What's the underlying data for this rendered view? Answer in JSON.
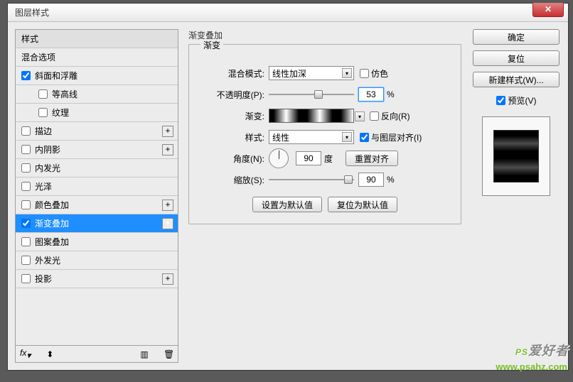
{
  "window": {
    "title": "图层样式"
  },
  "sidebar": {
    "header": "样式",
    "blendOptions": "混合选项",
    "items": [
      {
        "label": "斜面和浮雕",
        "checked": true,
        "plus": false,
        "indent": 1
      },
      {
        "label": "等高线",
        "checked": false,
        "plus": false,
        "indent": 2
      },
      {
        "label": "纹理",
        "checked": false,
        "plus": false,
        "indent": 2
      },
      {
        "label": "描边",
        "checked": false,
        "plus": true,
        "indent": 1
      },
      {
        "label": "内阴影",
        "checked": false,
        "plus": true,
        "indent": 1
      },
      {
        "label": "内发光",
        "checked": false,
        "plus": false,
        "indent": 1
      },
      {
        "label": "光泽",
        "checked": false,
        "plus": false,
        "indent": 1
      },
      {
        "label": "颜色叠加",
        "checked": false,
        "plus": true,
        "indent": 1
      },
      {
        "label": "渐变叠加",
        "checked": true,
        "plus": true,
        "indent": 1,
        "selected": true
      },
      {
        "label": "图案叠加",
        "checked": false,
        "plus": false,
        "indent": 1
      },
      {
        "label": "外发光",
        "checked": false,
        "plus": false,
        "indent": 1
      },
      {
        "label": "投影",
        "checked": false,
        "plus": true,
        "indent": 1
      }
    ],
    "footer": {
      "fx": "fx"
    }
  },
  "main": {
    "sectionTitle": "渐变叠加",
    "fieldsetTitle": "渐变",
    "blendMode": {
      "label": "混合模式:",
      "value": "线性加深"
    },
    "dither": "仿色",
    "opacity": {
      "label": "不透明度(P):",
      "value": "53",
      "percent": 53,
      "unit": "%"
    },
    "gradient": {
      "label": "渐变:"
    },
    "reverse": "反向(R)",
    "style": {
      "label": "样式:",
      "value": "线性"
    },
    "alignWithLayer": "与图层对齐(I)",
    "angle": {
      "label": "角度(N):",
      "value": "90",
      "unit": "度"
    },
    "resetAlign": "重置对齐",
    "scale": {
      "label": "缩放(S):",
      "value": "90",
      "percent": 90,
      "unit": "%"
    },
    "setDefault": "设置为默认值",
    "resetDefault": "复位为默认值"
  },
  "right": {
    "ok": "确定",
    "cancel": "复位",
    "newStyle": "新建样式(W)...",
    "preview": "预览(V)"
  },
  "watermark": {
    "brand": "PS",
    "brandSub": "爱好者",
    "url": "www.psahz.com"
  }
}
